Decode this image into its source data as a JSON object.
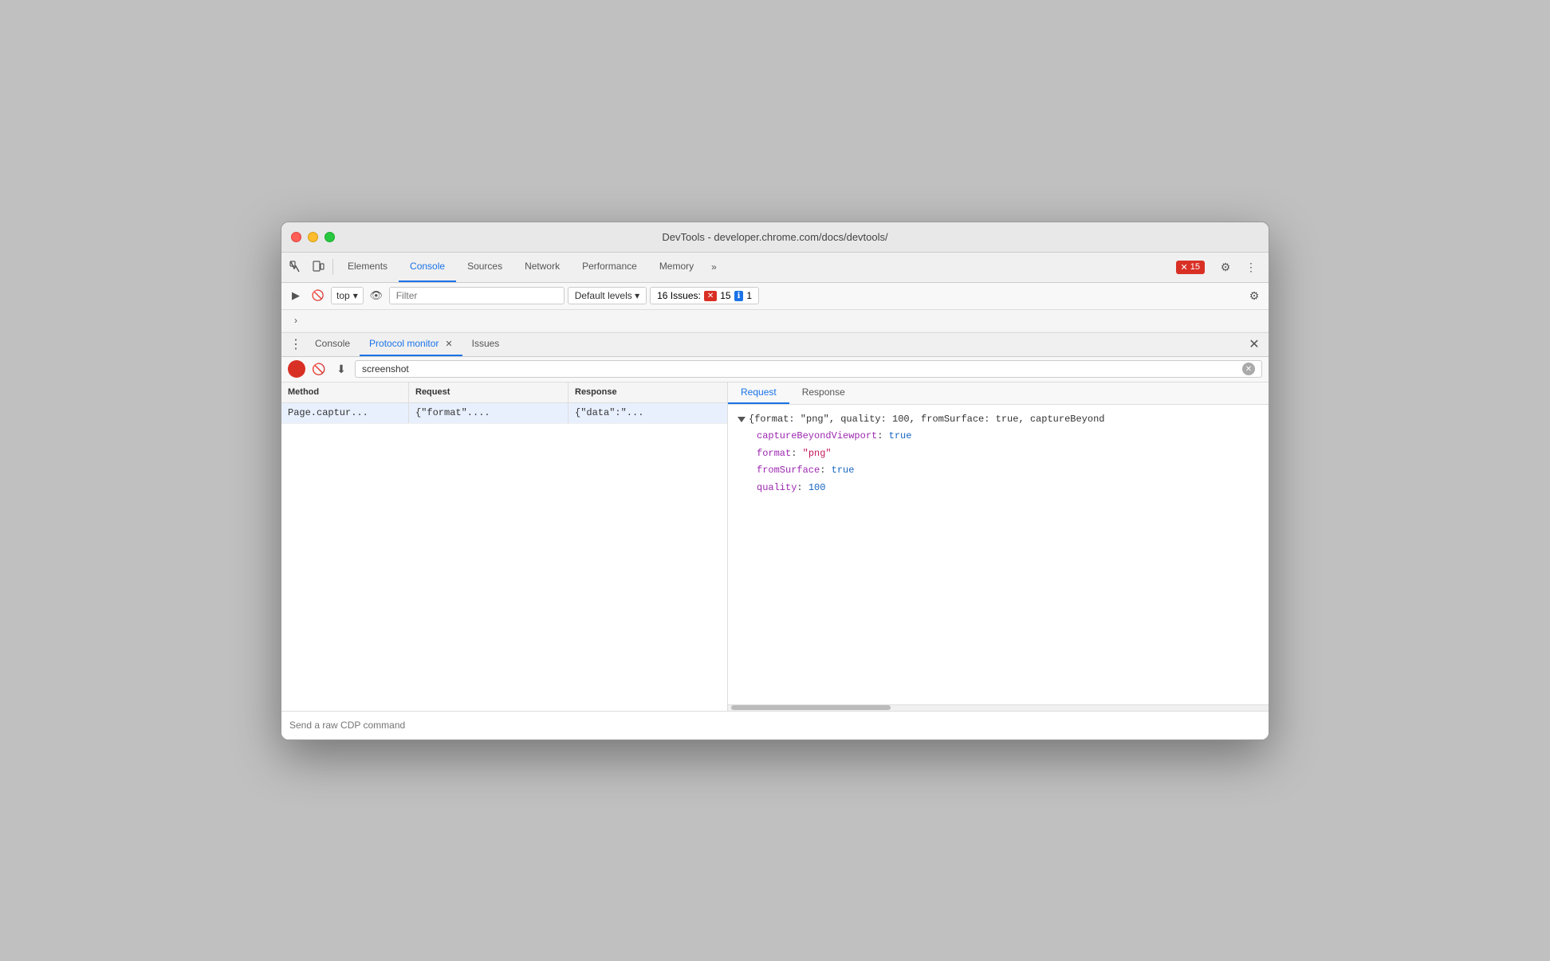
{
  "window": {
    "title": "DevTools - developer.chrome.com/docs/devtools/"
  },
  "nav": {
    "tabs": [
      {
        "id": "elements",
        "label": "Elements",
        "active": false
      },
      {
        "id": "console",
        "label": "Console",
        "active": true
      },
      {
        "id": "sources",
        "label": "Sources",
        "active": false
      },
      {
        "id": "network",
        "label": "Network",
        "active": false
      },
      {
        "id": "performance",
        "label": "Performance",
        "active": false
      },
      {
        "id": "memory",
        "label": "Memory",
        "active": false
      }
    ],
    "more_label": "»",
    "error_count": "15",
    "error_label": "✕ 15"
  },
  "console_toolbar": {
    "top_label": "top",
    "filter_placeholder": "Filter",
    "default_levels_label": "Default levels ▾",
    "issues_label": "16 Issues:",
    "error_count": "15",
    "info_count": "1"
  },
  "drawer": {
    "tabs": [
      {
        "id": "console",
        "label": "Console",
        "active": false
      },
      {
        "id": "protocol-monitor",
        "label": "Protocol monitor",
        "active": true
      },
      {
        "id": "issues",
        "label": "Issues",
        "active": false
      }
    ],
    "close_label": "✕"
  },
  "protocol_toolbar": {
    "search_value": "screenshot",
    "search_placeholder": "screenshot"
  },
  "table": {
    "headers": [
      "Method",
      "Request",
      "Response"
    ],
    "rows": [
      {
        "method": "Page.captur...",
        "request": "{\"format\"....",
        "response": "{\"data\":\"..."
      }
    ]
  },
  "detail": {
    "tabs": [
      "Request",
      "Response"
    ],
    "active_tab": "Request",
    "json_header": "{format: \"png\", quality: 100, fromSurface: true, captureBeyond",
    "properties": [
      {
        "key": "captureBeyondViewport",
        "value": "true",
        "type": "bool"
      },
      {
        "key": "format",
        "value": "\"png\"",
        "type": "string"
      },
      {
        "key": "fromSurface",
        "value": "true",
        "type": "bool"
      },
      {
        "key": "quality",
        "value": "100",
        "type": "num"
      }
    ]
  },
  "bottom_input": {
    "placeholder": "Send a raw CDP command"
  },
  "colors": {
    "accent_blue": "#1a73e8",
    "error_red": "#d93025",
    "key_purple": "#9c27b0",
    "value_pink": "#c2185b",
    "value_blue": "#1565c0"
  }
}
